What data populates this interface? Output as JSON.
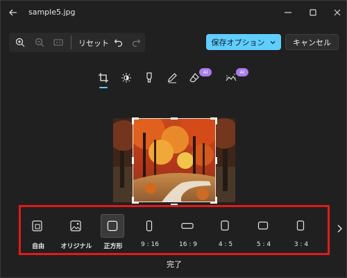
{
  "window": {
    "title": "sample5.jpg"
  },
  "toolbar": {
    "reset_label": "リセット",
    "zoom_in_icon": "zoom-in-icon",
    "zoom_out_icon": "zoom-out-icon",
    "fit_icon": "fit-to-window-icon",
    "undo_icon": "undo-icon",
    "redo_icon": "redo-icon"
  },
  "actions": {
    "save_label": "保存オプション",
    "cancel_label": "キャンセル"
  },
  "tools": [
    {
      "name": "crop-tool",
      "icon": "crop-icon",
      "selected": true
    },
    {
      "name": "adjust-tool",
      "icon": "brightness-icon",
      "selected": false
    },
    {
      "name": "markup-tool",
      "icon": "highlighter-icon",
      "selected": false
    },
    {
      "name": "draw-tool",
      "icon": "pen-icon",
      "selected": false
    },
    {
      "name": "erase-tool",
      "icon": "eraser-icon",
      "badge": "AI",
      "selected": false
    },
    {
      "name": "background-tool",
      "icon": "background-blur-icon",
      "badge": "AI",
      "selected": false
    }
  ],
  "aspect_ratios": [
    {
      "label": "自由",
      "icon": "freeform-crop-icon",
      "selected": false
    },
    {
      "label": "オリジナル",
      "icon": "image-icon",
      "selected": false
    },
    {
      "label": "正方形",
      "icon": "square-icon",
      "selected": true
    },
    {
      "label": "9 : 16",
      "icon": "portrait-9-16-icon",
      "selected": false
    },
    {
      "label": "16 : 9",
      "icon": "landscape-16-9-icon",
      "selected": false
    },
    {
      "label": "4 : 5",
      "icon": "portrait-4-5-icon",
      "selected": false
    },
    {
      "label": "5 : 4",
      "icon": "landscape-5-4-icon",
      "selected": false
    },
    {
      "label": "3 : 4",
      "icon": "portrait-3-4-icon",
      "selected": false
    }
  ],
  "done_label": "完了",
  "colors": {
    "accent": "#60cdff",
    "ai_badge": "#a97dea",
    "highlight_box": "#e11b1b",
    "background": "#202020"
  }
}
